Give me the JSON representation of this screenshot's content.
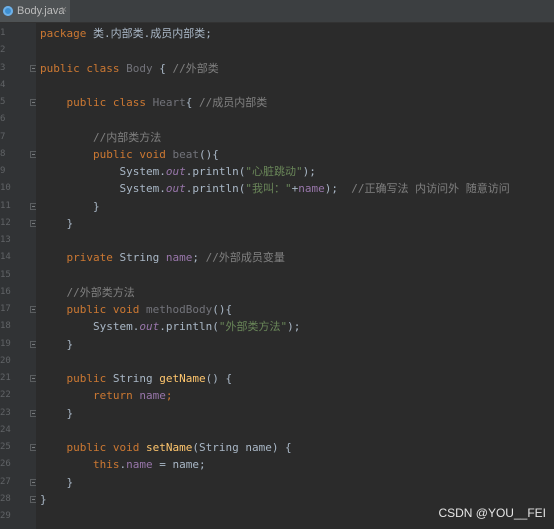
{
  "tab": {
    "label": "Body.java",
    "close": "×"
  },
  "lines": [
    {
      "num": "1",
      "parts": [
        [
          "kw",
          "package "
        ],
        [
          "grey",
          "类.内部类.成员内部类;"
        ]
      ]
    },
    {
      "num": "2",
      "parts": []
    },
    {
      "num": "3",
      "parts": [
        [
          "kw",
          "public class "
        ],
        [
          "unused",
          "Body"
        ],
        [
          "grey",
          " { "
        ],
        [
          "cmt",
          "//外部类"
        ]
      ]
    },
    {
      "num": "4",
      "parts": []
    },
    {
      "num": "5",
      "parts": [
        [
          "grey",
          "    "
        ],
        [
          "kw",
          "public class "
        ],
        [
          "unused",
          "Heart"
        ],
        [
          "grey",
          "{ "
        ],
        [
          "cmt",
          "//成员内部类"
        ]
      ]
    },
    {
      "num": "6",
      "parts": []
    },
    {
      "num": "7",
      "parts": [
        [
          "cmt",
          "        //内部类方法"
        ]
      ]
    },
    {
      "num": "8",
      "parts": [
        [
          "grey",
          "        "
        ],
        [
          "kw",
          "public void "
        ],
        [
          "unused",
          "beat"
        ],
        [
          "grey",
          "(){"
        ]
      ]
    },
    {
      "num": "9",
      "parts": [
        [
          "grey",
          "            System."
        ],
        [
          "stat",
          "out"
        ],
        [
          "grey",
          ".println("
        ],
        [
          "str",
          "\"心脏跳动\""
        ],
        [
          "grey",
          ");"
        ]
      ]
    },
    {
      "num": "10",
      "parts": [
        [
          "grey",
          "            System."
        ],
        [
          "stat",
          "out"
        ],
        [
          "grey",
          ".println("
        ],
        [
          "str",
          "\"我叫：\""
        ],
        [
          "grey",
          "+"
        ],
        [
          "fld",
          "name"
        ],
        [
          "grey",
          ");  "
        ],
        [
          "cmt",
          "//正确写法 内访问外 随意访问"
        ]
      ]
    },
    {
      "num": "11",
      "parts": [
        [
          "grey",
          "        }"
        ]
      ]
    },
    {
      "num": "12",
      "parts": [
        [
          "grey",
          "    }"
        ]
      ]
    },
    {
      "num": "13",
      "parts": []
    },
    {
      "num": "14",
      "parts": [
        [
          "grey",
          "    "
        ],
        [
          "kw",
          "private "
        ],
        [
          "grey",
          "String "
        ],
        [
          "fld",
          "name"
        ],
        [
          "grey",
          "; "
        ],
        [
          "cmt",
          "//外部成员变量"
        ]
      ]
    },
    {
      "num": "15",
      "parts": []
    },
    {
      "num": "16",
      "parts": [
        [
          "cmt",
          "    //外部类方法"
        ]
      ]
    },
    {
      "num": "17",
      "parts": [
        [
          "grey",
          "    "
        ],
        [
          "kw",
          "public void "
        ],
        [
          "unused",
          "methodBody"
        ],
        [
          "grey",
          "(){"
        ]
      ]
    },
    {
      "num": "18",
      "parts": [
        [
          "grey",
          "        System."
        ],
        [
          "stat",
          "out"
        ],
        [
          "grey",
          ".println("
        ],
        [
          "str",
          "\"外部类方法\""
        ],
        [
          "grey",
          ");"
        ]
      ]
    },
    {
      "num": "19",
      "parts": [
        [
          "grey",
          "    }"
        ]
      ]
    },
    {
      "num": "20",
      "parts": []
    },
    {
      "num": "21",
      "parts": [
        [
          "grey",
          "    "
        ],
        [
          "kw",
          "public "
        ],
        [
          "grey",
          "String "
        ],
        [
          "mdecl",
          "getName"
        ],
        [
          "grey",
          "() {"
        ]
      ]
    },
    {
      "num": "22",
      "parts": [
        [
          "grey",
          "        "
        ],
        [
          "kw",
          "return "
        ],
        [
          "fld",
          "name"
        ],
        [
          "kw",
          ";"
        ]
      ]
    },
    {
      "num": "23",
      "parts": [
        [
          "grey",
          "    }"
        ]
      ]
    },
    {
      "num": "24",
      "parts": []
    },
    {
      "num": "25",
      "parts": [
        [
          "grey",
          "    "
        ],
        [
          "kw",
          "public void "
        ],
        [
          "mdecl",
          "setName"
        ],
        [
          "grey",
          "(String name) {"
        ]
      ]
    },
    {
      "num": "26",
      "parts": [
        [
          "grey",
          "        "
        ],
        [
          "kw",
          "this"
        ],
        [
          "grey",
          "."
        ],
        [
          "fld",
          "name"
        ],
        [
          "grey",
          " = name;"
        ]
      ]
    },
    {
      "num": "27",
      "parts": [
        [
          "grey",
          "    }"
        ]
      ]
    },
    {
      "num": "28",
      "parts": [
        [
          "grey",
          "}"
        ]
      ]
    },
    {
      "num": "29",
      "parts": []
    }
  ],
  "folds": [
    "3",
    "5",
    "8",
    "11",
    "12",
    "17",
    "19",
    "21",
    "23",
    "25",
    "27",
    "28"
  ],
  "watermark": "CSDN @YOU__FEI",
  "colors": {
    "keyword": "#cc7832",
    "string": "#6a8759",
    "comment": "#808080",
    "field": "#9876aa",
    "method": "#ffc66d",
    "text": "#a9b7c6",
    "background": "#2b2b2b"
  }
}
